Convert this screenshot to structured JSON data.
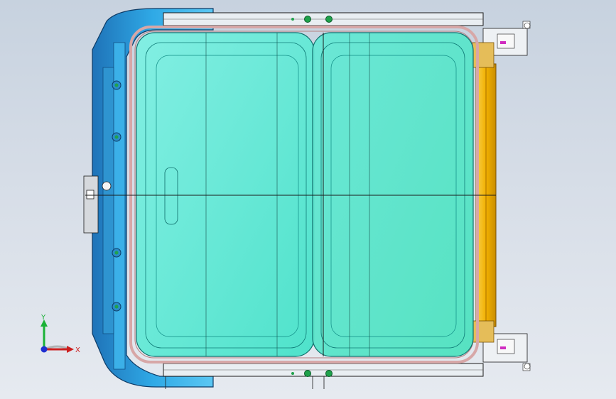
{
  "app": {
    "title": "",
    "view": "Top view"
  },
  "viewport": {
    "background_top": "#c7d2df",
    "background_bottom": "#e6eaf0",
    "model": {
      "part": "sunroof-assembly",
      "colors": {
        "frame": "#2fa9e6",
        "frame_dark": "#1f5f9a",
        "glass_front": "#47e2c9",
        "glass_rear": "#57e6c6",
        "glass_highlight": "#7ff0e3",
        "seal": "#d7a7a7",
        "rail": "#e9eef2",
        "rail_stroke": "#1b1b1b",
        "drive_bar": "#f0b000",
        "marker_green": "#1fa24b",
        "marker_magenta": "#d02cc0"
      }
    }
  },
  "triad": {
    "x_label": "X",
    "y_label": "Y",
    "x_color": "#cc1f1f",
    "y_color": "#1bb236",
    "z_color": "#1f2fd0"
  }
}
